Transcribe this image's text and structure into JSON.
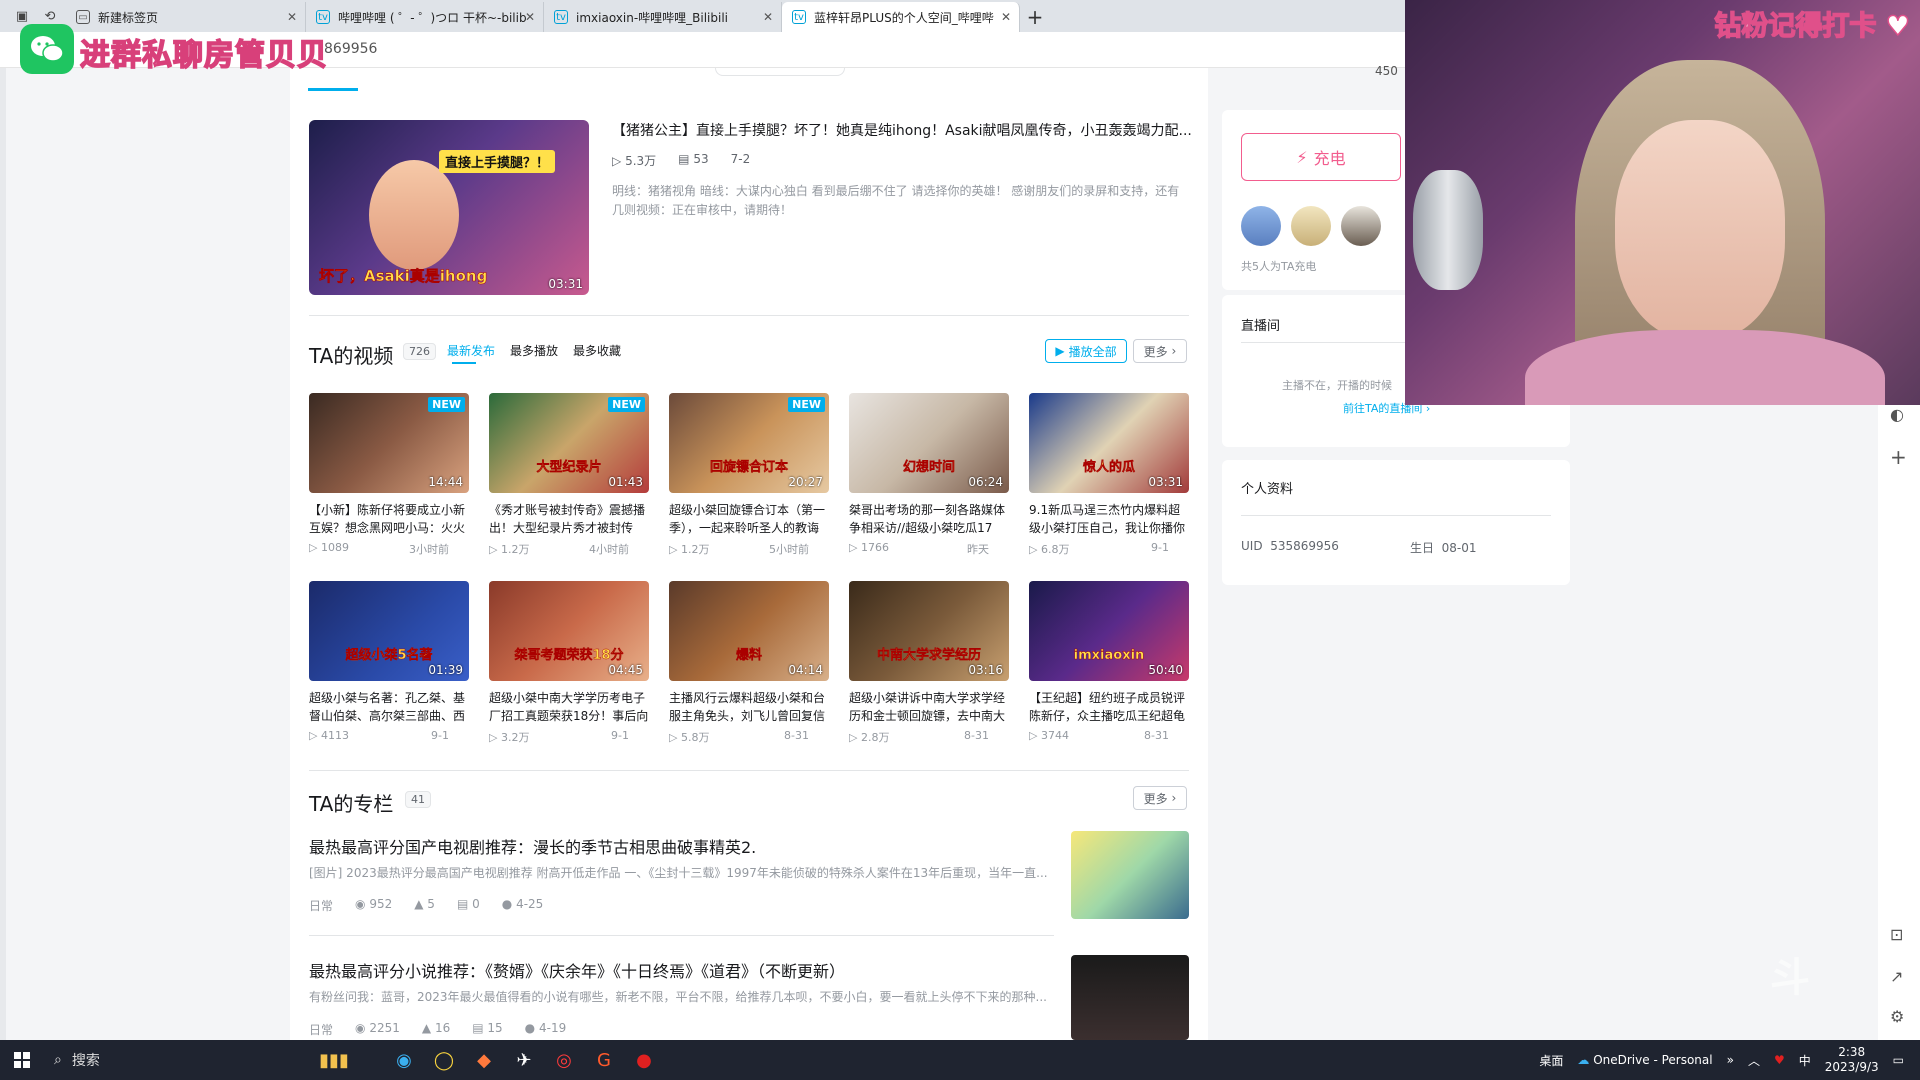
{
  "browser": {
    "tabs": [
      {
        "title": "新建标签页",
        "active": false
      },
      {
        "title": "哔哩哔哩 ( ゜- ゜)つロ 干杯~-bilib",
        "active": false
      },
      {
        "title": "imxiaoxin-哔哩哔哩_Bilibili",
        "active": false
      },
      {
        "title": "蓝梓轩昂PLUS的个人空间_哔哩哔",
        "active": true
      }
    ],
    "address": "869956"
  },
  "overlay": {
    "promo_text": "进群私聊房管贝贝",
    "webcam_text": "钻粉记得打卡"
  },
  "space": {
    "nav_count": "450",
    "featured": {
      "title": "【猪猪公主】直接上手摸腿？坏了！她真是纯ihong！Asaki献唱凤凰传奇，小丑轰轰竭力配...",
      "views": "5.3万",
      "comments": "53",
      "date": "7-2",
      "desc": "明线：猪猪视角 暗线：大谋内心独白 看到最后绷不住了 请选择你的英雄！ 感谢朋友们的录屏和支持，还有几则视频：正在审核中，请期待！",
      "duration": "03:31",
      "thumb_banner": "直接上手摸腿？！",
      "thumb_caption": "坏了，Asaki真是ihong"
    },
    "videos_section": {
      "title": "TA的视频",
      "count": "726",
      "tabs": [
        "最新发布",
        "最多播放",
        "最多收藏"
      ],
      "play_all": "播放全部",
      "more": "更多"
    },
    "videos": [
      {
        "title": "【小新】陈新仔将要成立小新互娱？想念黑网吧小马：火火",
        "views": "1089",
        "time": "3小时前",
        "duration": "14:44",
        "new": true,
        "cap": ""
      },
      {
        "title": "《秀才账号被封传奇》震撼播出！大型纪录片秀才被封传",
        "views": "1.2万",
        "time": "4小时前",
        "duration": "01:43",
        "new": true,
        "cap": "大型纪录片"
      },
      {
        "title": "超级小桀回旋镖合订本（第一季），一起来聆听圣人的教诲",
        "views": "1.2万",
        "time": "5小时前",
        "duration": "20:27",
        "new": true,
        "cap": "回旋镖合订本"
      },
      {
        "title": "桀哥出考场的那一刻各路媒体争相采访//超级小桀吃瓜17",
        "views": "1766",
        "time": "昨天",
        "duration": "06:24",
        "new": false,
        "cap": "幻想时间"
      },
      {
        "title": "9.1新瓜马逞三杰竹内爆料超级小桀打压自己，我让你播你",
        "views": "6.8万",
        "time": "9-1",
        "duration": "03:31",
        "new": false,
        "cap": "惊人的瓜"
      },
      {
        "title": "超级小桀与名著：孔乙桀、基督山伯桀、高尔桀三部曲、西",
        "views": "4113",
        "time": "9-1",
        "duration": "01:39",
        "new": false,
        "cap": "超级小桀5名著"
      },
      {
        "title": "超级小桀中南大学学历考电子厂招工真题荣获18分！事后向",
        "views": "3.2万",
        "time": "9-1",
        "duration": "04:45",
        "new": false,
        "cap": "桀哥考题荣获18分"
      },
      {
        "title": "主播风行云爆料超级小桀和台服主角免头，刘飞儿曾回复信",
        "views": "5.8万",
        "time": "8-31",
        "duration": "04:14",
        "new": false,
        "cap": "爆料"
      },
      {
        "title": "超级小桀讲诉中南大学求学经历和金士顿回旋镖，去中南大",
        "views": "2.8万",
        "time": "8-31",
        "duration": "03:16",
        "new": false,
        "cap": "中南大学求学经历"
      },
      {
        "title": "【王纪超】纽约班子成员锐评陈新仔，众主播吃瓜王纪超龟",
        "views": "3744",
        "time": "8-31",
        "duration": "50:40",
        "new": false,
        "cap": "imxiaoxin"
      }
    ],
    "articles_section": {
      "title": "TA的专栏",
      "count": "41",
      "more": "更多"
    },
    "articles": [
      {
        "title": "最热最高评分国产电视剧推荐：漫长的季节古相思曲破事精英2.",
        "desc": "[图片] 2023最热评分最高国产电视剧推荐 附高开低走作品 一、《尘封十三载》1997年未能侦破的特殊杀人案件在13年后重现，当年一直...",
        "category": "日常",
        "views": "952",
        "likes": "5",
        "comments": "0",
        "date": "4-25"
      },
      {
        "title": "最热最高评分小说推荐：《赘婿》《庆余年》《十日终焉》《道君》（不断更新）",
        "desc": "有粉丝问我：蓝哥，2023年最火最值得看的小说有哪些，新老不限，平台不限，给推荐几本呗，不要小白，要一看就上头停不下来的那种...",
        "category": "日常",
        "views": "2251",
        "likes": "16",
        "comments": "15",
        "date": "4-19"
      }
    ],
    "sidebar": {
      "charge_button": "充电",
      "charge_count_text": "共5人为TA充电",
      "live_title": "直播间",
      "live_status": "主播不在，开播的时候",
      "live_link": "前往TA的直播间",
      "profile_title": "个人资料",
      "uid_label": "UID",
      "uid": "535869956",
      "birthday_label": "生日",
      "birthday": "08-01"
    }
  },
  "taskbar": {
    "search_label": "搜索",
    "desktop": "桌面",
    "onedrive": "OneDrive - Personal",
    "ime": "中",
    "time": "2:38",
    "date": "2023/9/3"
  },
  "colors": {
    "accent": "#00aeec",
    "charge": "#f25d8e",
    "taskbar": "#1f2430"
  }
}
